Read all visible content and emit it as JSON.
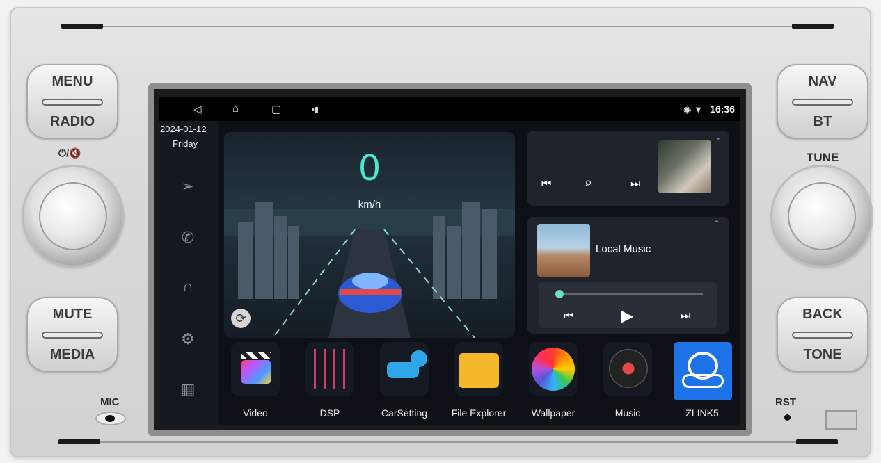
{
  "hardware": {
    "left_top_button": {
      "top": "MENU",
      "bottom": "RADIO"
    },
    "left_bottom_button": {
      "top": "MUTE",
      "bottom": "MEDIA"
    },
    "right_top_button": {
      "top": "NAV",
      "bottom": "BT"
    },
    "right_bottom_button": {
      "top": "BACK",
      "bottom": "TONE"
    },
    "left_knob_label": "⏻/🔇",
    "right_knob_label": "TUNE",
    "mic_label": "MIC",
    "rst_label": "RST"
  },
  "status_bar": {
    "time": "16:36",
    "back_icon": "back-triangle-icon",
    "home_icon": "home-icon",
    "recents_icon": "recents-square-icon"
  },
  "sidebar": {
    "date": "2024-01-12",
    "day": "Friday",
    "items": [
      "navigation-icon",
      "phone-icon",
      "bluetooth-headphones-icon",
      "settings-gear-icon",
      "apps-grid-icon"
    ]
  },
  "dashboard": {
    "speed": "0",
    "unit": "km/h"
  },
  "radio_panel": {
    "controls": [
      "prev-icon",
      "search-icon",
      "next-icon"
    ]
  },
  "music_panel": {
    "title": "Local Music",
    "progress": 0.0,
    "controls": [
      "prev-icon",
      "play-icon",
      "next-icon"
    ]
  },
  "apps": [
    {
      "name": "Video",
      "icon": "video-clapper-icon"
    },
    {
      "name": "DSP",
      "icon": "equalizer-icon"
    },
    {
      "name": "CarSetting",
      "icon": "car-gear-icon"
    },
    {
      "name": "File Explorer",
      "icon": "folder-icon"
    },
    {
      "name": "Wallpaper",
      "icon": "color-wheel-icon"
    },
    {
      "name": "Music",
      "icon": "vinyl-record-icon"
    },
    {
      "name": "ZLINK5",
      "icon": "zlink-car-icon"
    }
  ],
  "colors": {
    "speed": "#49e6d0",
    "zlink_bg": "#1e73e8"
  }
}
